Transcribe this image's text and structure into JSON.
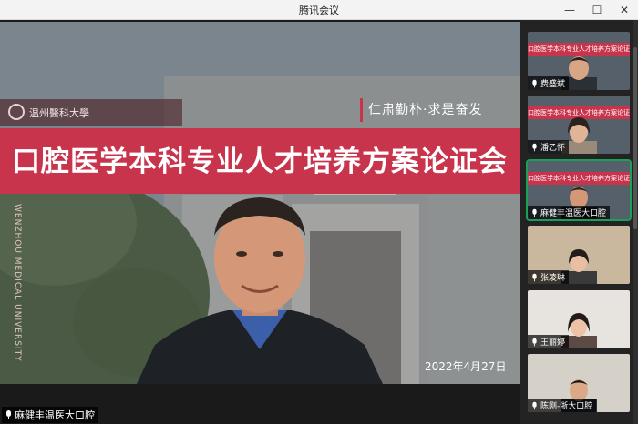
{
  "window": {
    "title": "腾讯会议",
    "controls": {
      "minimize": "—",
      "maximize": "☐",
      "close": "✕"
    }
  },
  "stage": {
    "banner_title": "口腔医学本科专业人才培养方案论证会",
    "logo_text": "温州醫科大學",
    "motto": "仁肃勤朴·求是奋发",
    "vertical_text": "WENZHOU MEDICAL UNIVERSITY",
    "date": "2022年4月27日",
    "speaker_label": "麻健丰温医大口腔"
  },
  "participants": [
    {
      "name": "费盛斌",
      "banner": "口腔医学本科专业人才培养方案论证会",
      "active": false
    },
    {
      "name": "潘乙怀",
      "banner": "口腔医学本科专业人才培养方案论证会",
      "active": false
    },
    {
      "name": "麻健丰温医大口腔",
      "banner": "口腔医学本科专业人才培养方案论证会",
      "active": true
    },
    {
      "name": "张凌琳",
      "banner": "",
      "active": false
    },
    {
      "name": "王丽婷",
      "banner": "",
      "active": false
    },
    {
      "name": "陈刚-浙大口腔",
      "banner": "",
      "active": false
    }
  ],
  "colors": {
    "accent": "#c9344d",
    "active_outline": "#1ba155"
  }
}
